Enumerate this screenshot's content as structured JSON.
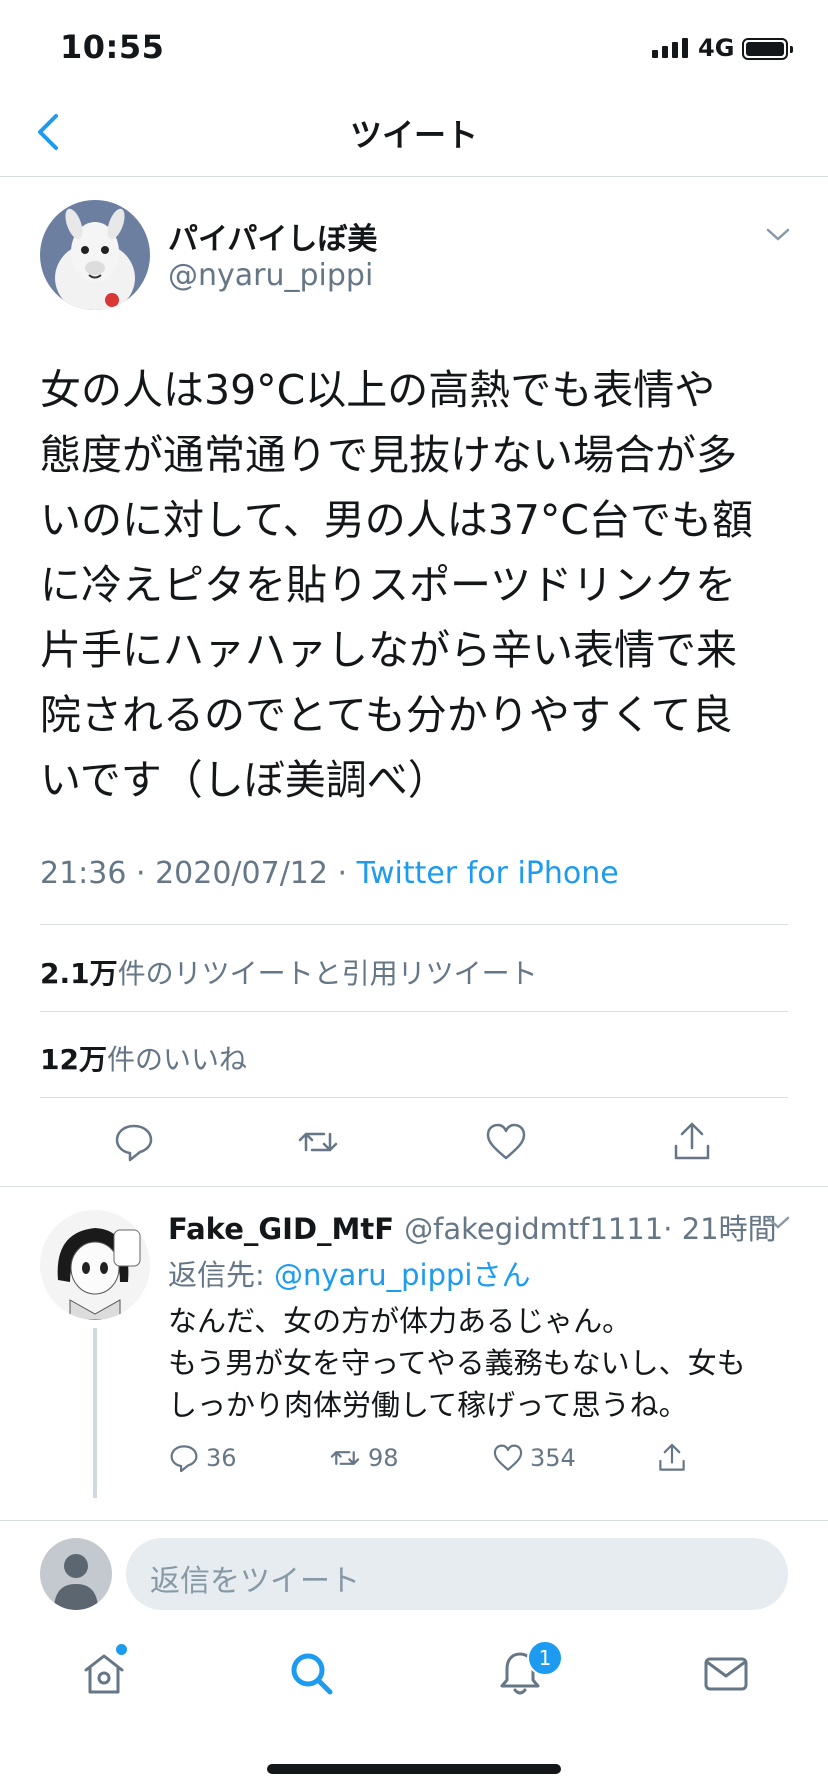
{
  "status": {
    "time": "10:55",
    "network": "4G"
  },
  "nav": {
    "title": "ツイート"
  },
  "tweet": {
    "author_name": "パイパイしぼ美",
    "author_handle": "@nyaru_pippi",
    "text": "女の人は39°C以上の高熱でも表情や\n態度が通常通りで見抜けない場合が多\nいのに対して、男の人は37°C台でも額\nに冷えピタを貼りスポーツドリンクを\n片手にハァハァしながら辛い表情で来\n院されるのでとても分かりやすくて良\nいです（しぼ美調べ）",
    "timestamp": "21:36 · 2020/07/12 · ",
    "source": "Twitter for iPhone",
    "retweets_count": "2.1万",
    "retweets_label": "件のリツイートと引用リツイート",
    "likes_count": "12万",
    "likes_label": "件のいいね"
  },
  "reply": {
    "name": "Fake_GID_MtF",
    "handle": "@fakegidmtf1111",
    "time": "· 21時間",
    "reply_to_prefix": "返信先: ",
    "reply_to_handle": "@nyaru_pippiさん",
    "text": "なんだ、女の方が体力あるじゃん。\nもう男が女を守ってやる義務もないし、女も\nしっかり肉体労働して稼げって思うね。",
    "replies": "36",
    "retweets": "98",
    "likes": "354"
  },
  "composer": {
    "placeholder": "返信をツイート"
  },
  "tabbar": {
    "notifications_badge": "1"
  },
  "colors": {
    "accent": "#1d9bf0",
    "muted": "#657786",
    "text": "#14171a",
    "divider": "#d9dee2"
  },
  "icons": [
    "back-chevron-icon",
    "caret-down-icon",
    "reply-icon",
    "retweet-icon",
    "like-icon",
    "share-icon",
    "home-icon",
    "search-icon",
    "bell-icon",
    "mail-icon"
  ]
}
